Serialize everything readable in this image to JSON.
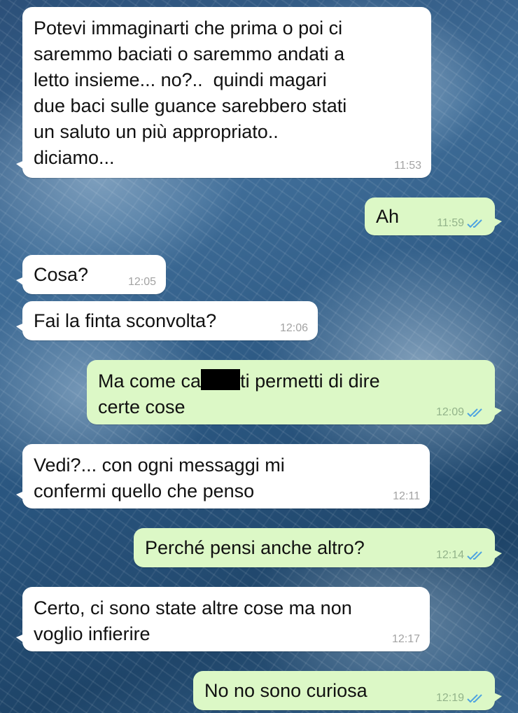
{
  "messages": [
    {
      "dir": "in",
      "text": "Potevi immaginarti che prima o poi ci\nsaremmo baciati o saremmo andati a\nletto insieme... no?..  quindi magari\ndue baci sulle guance sarebbero stati\nun saluto un più appropriato..\ndiciamo...",
      "time": "11:53"
    },
    {
      "dir": "out",
      "text": "Ah",
      "time": "11:59",
      "status_icon": "double-check-icon"
    },
    {
      "dir": "in",
      "text": "Cosa?",
      "time": "12:05"
    },
    {
      "dir": "in",
      "text": "Fai la finta sconvolta?",
      "time": "12:06"
    },
    {
      "dir": "out",
      "text_before": "Ma come ca",
      "text_after": "ti permetti di dire\ncerte cose",
      "time": "12:09",
      "status_icon": "double-check-icon"
    },
    {
      "dir": "in",
      "text": "Vedi?... con ogni messaggi mi\nconfermi quello che penso",
      "time": "12:11"
    },
    {
      "dir": "out",
      "text": "Perché pensi anche altro?",
      "time": "12:14",
      "status_icon": "double-check-icon"
    },
    {
      "dir": "in",
      "text": "Certo, ci sono state altre cose ma non\nvoglio infierire",
      "time": "12:17"
    },
    {
      "dir": "out",
      "text": "No no sono curiosa",
      "time": "12:19",
      "status_icon": "double-check-icon"
    }
  ],
  "colors": {
    "incoming": "#ffffff",
    "outgoing": "#dcf8c6",
    "read_check": "#4fa3e0"
  }
}
